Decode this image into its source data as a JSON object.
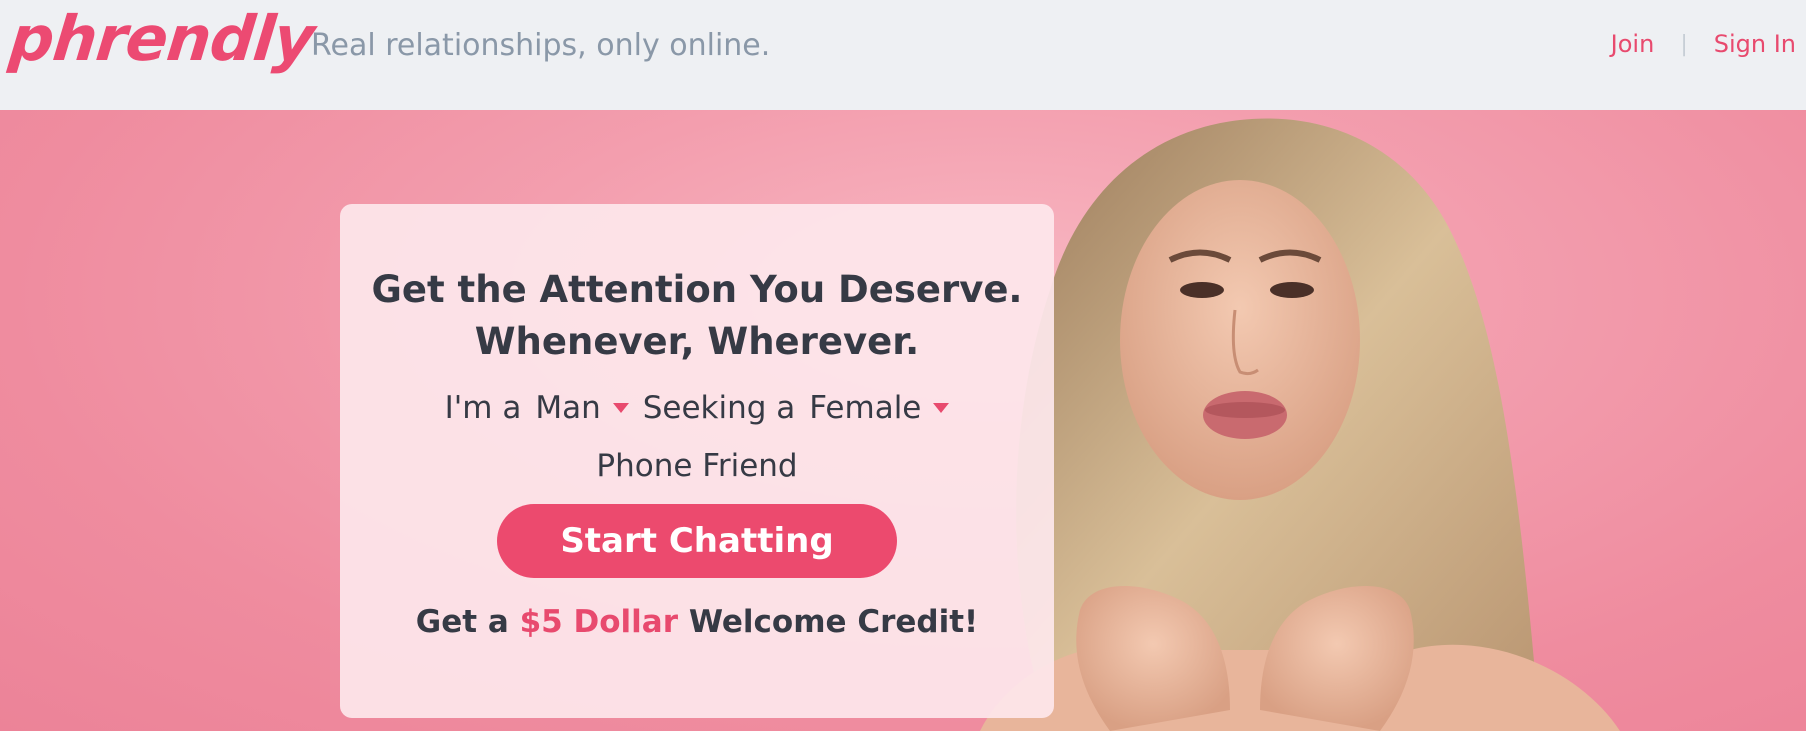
{
  "header": {
    "logo": "phrendly",
    "tagline": "Real relationships, only online.",
    "nav": {
      "join": "Join",
      "separator": "|",
      "sign_in": "Sign In"
    }
  },
  "hero": {
    "headline_line1": "Get the Attention You Deserve.",
    "headline_line2": "Whenever, Wherever.",
    "im_a_label": "I'm a",
    "gender_value": "Man",
    "seeking_label": "Seeking a",
    "seeking_value": "Female",
    "seeking_type": "Phone Friend",
    "cta_label": "Start Chatting",
    "credit_prefix": "Get a",
    "credit_amount": "$5 Dollar",
    "credit_suffix": "Welcome Credit!"
  },
  "colors": {
    "brand": "#ec4a72",
    "header_bg": "#eef0f3",
    "hero_bg": "#f39eae",
    "text_dark": "#363a45",
    "tagline_gray": "#8a98a8"
  },
  "icons": [
    "chevron-down-icon"
  ]
}
